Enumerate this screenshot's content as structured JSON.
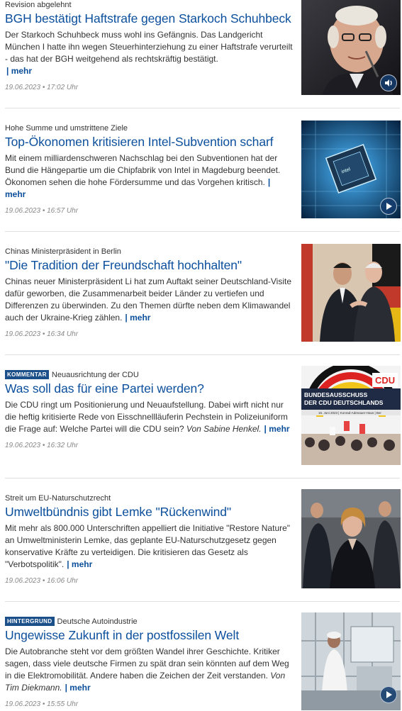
{
  "teasers": [
    {
      "topline": "Revision abgelehnt",
      "headline": "BGH bestätigt Haftstrafe gegen Starkoch Schuhbeck",
      "body": "Der Starkoch Schuhbeck muss wohl ins Gefängnis. Das Landgericht München I hatte ihn wegen Steuerhinterziehung zu einer Haftstrafe verurteilt - das hat der BGH weitgehend als rechtskräftig bestätigt.",
      "more": "| mehr",
      "date": "19.06.2023 • 17:02 Uhr",
      "media": "audio-icon"
    },
    {
      "topline": "Hohe Summe und umstrittene Ziele",
      "headline": "Top-Ökonomen kritisieren Intel-Subvention scharf",
      "body": "Mit einem milliardenschweren Nachschlag bei den Subventionen hat der Bund die Hängepartie um die Chipfabrik von Intel in Magdeburg beendet. Ökonomen sehen die hohe Fördersumme und das Vorgehen kritisch.",
      "more": "| mehr",
      "date": "19.06.2023 • 16:57 Uhr",
      "media": "play-icon"
    },
    {
      "topline": "Chinas Ministerpräsident in Berlin",
      "headline": "\"Die Tradition der Freundschaft hochhalten\"",
      "body": "Chinas neuer Ministerpräsident Li hat zum Auftakt seiner Deutschland-Visite dafür geworben, die Zusammenarbeit beider Länder zu vertiefen und Differenzen zu überwinden. Zu den Themen dürfte neben dem Klimawandel auch der Ukraine-Krieg zählen.",
      "more": "| mehr",
      "date": "19.06.2023 • 16:34 Uhr"
    },
    {
      "badge": "KOMMENTAR",
      "topline": "Neuausrichtung der CDU",
      "headline": "Was soll das für eine Partei werden?",
      "body": "Die CDU ringt um Positionierung und Neuaufstellung. Dabei wirft nicht nur die heftig kritisierte Rede von Eisschnellläuferin Pechstein in Polizeiuniform die Frage auf: Welche Partei will die CDU sein?",
      "author": "Von Sabine Henkel.",
      "more": "| mehr",
      "date": "19.06.2023 • 16:32 Uhr",
      "image_text": {
        "cdu": "CDU",
        "banner_line1": "BUNDESAUSSCHUSS",
        "banner_line2": "DER CDU DEUTSCHLANDS",
        "banner_sub": "16. Juni 2023 | Konrad-Adenauer-Haus | Ber"
      }
    },
    {
      "topline": "Streit um EU-Naturschutzrecht",
      "headline": "Umweltbündnis gibt Lemke \"Rückenwind\"",
      "body": "Mit mehr als 800.000 Unterschriften appelliert die Initiative \"Restore Nature\" an Umweltministerin Lemke, das geplante EU-Naturschutzgesetz gegen konservative Kräfte zu verteidigen. Die kritisieren das Gesetz als \"Verbotspolitik\".",
      "more": "| mehr",
      "date": "19.06.2023 • 16:06 Uhr"
    },
    {
      "badge": "HINTERGRUND",
      "topline": "Deutsche Autoindustrie",
      "headline": "Ungewisse Zukunft in der postfossilen Welt",
      "body": "Die Autobranche steht vor dem größten Wandel ihrer Geschichte. Kritiker sagen, dass viele deutsche Firmen zu spät dran sein könnten auf dem Weg in die Elektromobilität. Andere haben die Zeichen der Zeit verstanden.",
      "author": "Von Tim Diekmann.",
      "more": "| mehr",
      "date": "19.06.2023 • 15:55 Uhr",
      "media": "play-icon"
    }
  ],
  "colors": {
    "headline": "#0b4f9c",
    "badge_bg": "#1b4f8a",
    "date": "#888888",
    "separator": "#e0e0e0"
  }
}
